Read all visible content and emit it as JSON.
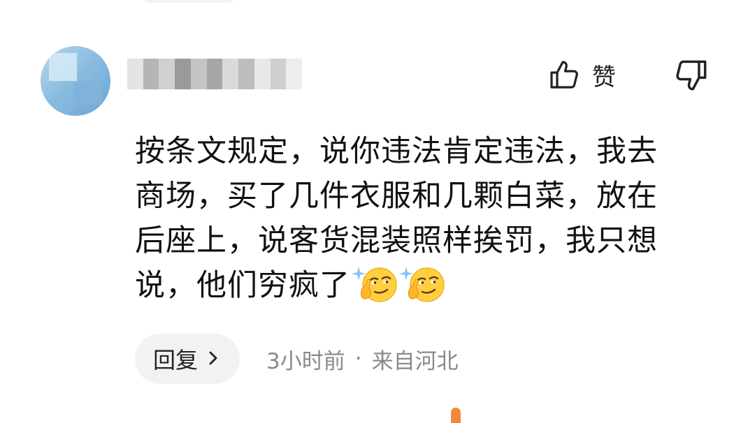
{
  "comment": {
    "username": "",
    "like_label": "赞",
    "body_lines": [
      "按条文规定，说你违法肯定违法，我去",
      "商场，买了几件衣服和几颗白菜，放在",
      "后座上，说客货混装照样挨罚，我只想",
      "说，他们穷疯了"
    ],
    "emojis": [
      "smirk-emoji",
      "smirk-emoji"
    ],
    "reply_label": "回复",
    "time": "3小时前",
    "separator": "·",
    "location": "来自河北"
  },
  "icons": {
    "like": "thumbs-up-icon",
    "dislike": "thumbs-down-icon",
    "reply_chevron": "chevron-right-icon"
  },
  "colors": {
    "text": "#111111",
    "meta": "#8a8a8a",
    "reply_bg": "#f2f2f2"
  }
}
